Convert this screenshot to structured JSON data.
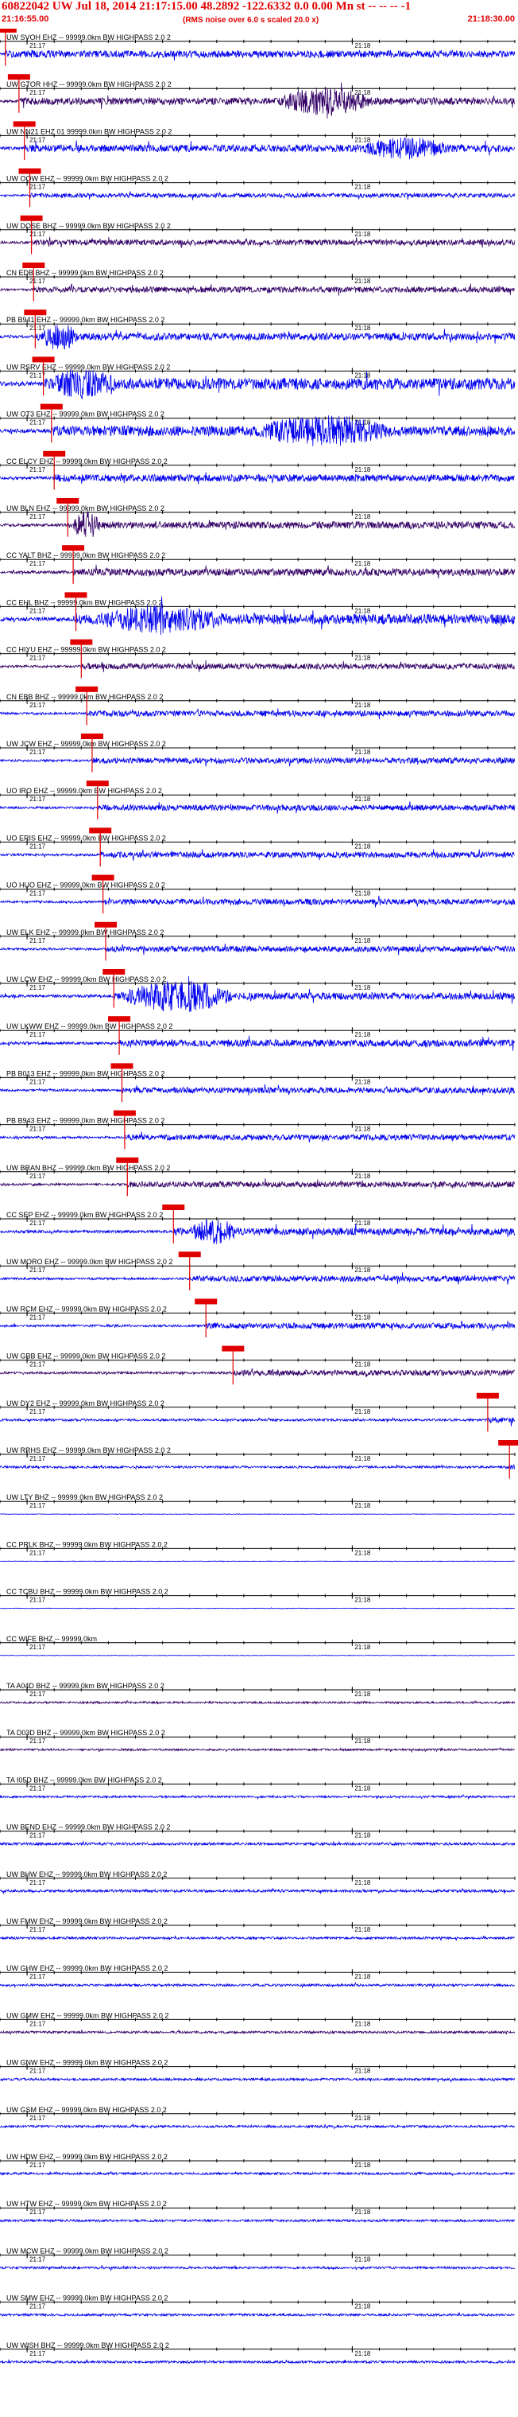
{
  "header": {
    "title": "60822042 UW Jul 18, 2014 21:17:15.00    48.2892  -122.6332   0.0 0.00 Mn st -- -- --   -1",
    "start_time": "21:16:55.00",
    "note": "(RMS noise over 6.0 s scaled 20.0 x)",
    "end_time": "21:18:30.00"
  },
  "colors": {
    "header_text": "#e00000",
    "pick_marker": "#e00000",
    "trace_blue": "#0000ee",
    "trace_purple": "#330066",
    "axis": "#000000"
  },
  "chart_data": {
    "type": "line",
    "title": "60822042 UW Jul 18, 2014 21:17:15.00    48.2892  -122.6332   0.0 0.00 Mn st -- -- --   -1",
    "x_start": "21:16:55.00",
    "x_end": "21:18:30.00",
    "minute_labels": [
      "21:17",
      "21:18"
    ],
    "series": [
      {
        "name": "UW SVOH EHZ -- 99999.0km BW  HIGHPASS  2.0  2",
        "pick": "21:16:56.0",
        "amplitude": 0.5,
        "burst": null,
        "color": "blue"
      },
      {
        "name": "UW GTOR HHZ -- 99999.0km BW  HIGHPASS  2.0  2",
        "pick": "21:16:58.5",
        "amplitude": 0.5,
        "burst": {
          "start": "21:17:45",
          "end": "21:18:05",
          "peak": 0.9
        },
        "color": "purple"
      },
      {
        "name": "UW NN21 EHZ 01 99999.0km BW  HIGHPASS  2.0  2",
        "pick": "21:16:59.5",
        "amplitude": 0.5,
        "burst": {
          "start": "21:18:00",
          "end": "21:18:20",
          "peak": 0.7
        },
        "color": "blue"
      },
      {
        "name": "UW OOW EHZ -- 99999.0km BW  HIGHPASS  2.0  2",
        "pick": "21:17:00.5",
        "amplitude": 0.3,
        "burst": null,
        "color": "blue"
      },
      {
        "name": "UW DOSE BHZ -- 99999.0km BW  HIGHPASS  2.0  2",
        "pick": "21:17:00.8",
        "amplitude": 0.4,
        "burst": null,
        "color": "purple"
      },
      {
        "name": "CN EDB BHZ -- 99999.0km BW  HIGHPASS  2.0  2",
        "pick": "21:17:01.2",
        "amplitude": 0.4,
        "burst": null,
        "color": "purple"
      },
      {
        "name": "PB B941 EHZ -- 99999.0km BW  HIGHPASS  2.0  2",
        "pick": "21:17:01.5",
        "amplitude": 0.5,
        "burst": {
          "start": "21:17:02",
          "end": "21:17:10",
          "peak": 0.9
        },
        "color": "blue"
      },
      {
        "name": "UW RSRV EHZ -- 99999.0km BW  HIGHPASS  2.0  2",
        "pick": "21:17:03.0",
        "amplitude": 0.8,
        "burst": {
          "start": "21:17:03",
          "end": "21:17:18",
          "peak": 1.0
        },
        "color": "blue"
      },
      {
        "name": "UW OT3 EHZ -- 99999.0km BW  HIGHPASS  2.0  2",
        "pick": "21:17:04.5",
        "amplitude": 0.7,
        "burst": {
          "start": "21:17:40",
          "end": "21:18:10",
          "peak": 1.0
        },
        "color": "blue"
      },
      {
        "name": "CC ELCY EHZ -- 99999.0km BW  HIGHPASS  2.0  2",
        "pick": "21:17:05.0",
        "amplitude": 0.5,
        "burst": null,
        "color": "blue"
      },
      {
        "name": "UW BLN EHZ -- 99999.0km BW  HIGHPASS  2.0  2",
        "pick": "21:17:07.5",
        "amplitude": 0.5,
        "burst": {
          "start": "21:17:08",
          "end": "21:17:14",
          "peak": 0.9
        },
        "color": "purple"
      },
      {
        "name": "CC YALT BHZ -- 99999.0km BW  HIGHPASS  2.0  2",
        "pick": "21:17:08.5",
        "amplitude": 0.5,
        "burst": null,
        "color": "purple"
      },
      {
        "name": "CC EHL BHZ -- 99999.0km BW  HIGHPASS  2.0  2",
        "pick": "21:17:09.0",
        "amplitude": 0.7,
        "burst": {
          "start": "21:17:10",
          "end": "21:17:40",
          "peak": 0.9
        },
        "color": "blue"
      },
      {
        "name": "CC HIYU EHZ -- 99999.0km BW  HIGHPASS  2.0  2",
        "pick": "21:17:10.0",
        "amplitude": 0.4,
        "burst": null,
        "color": "purple"
      },
      {
        "name": "CN EBB BHZ -- 99999.0km BW  HIGHPASS  2.0  2",
        "pick": "21:17:11.0",
        "amplitude": 0.4,
        "burst": null,
        "color": "blue"
      },
      {
        "name": "UW JCW EHZ -- 99999.0km BW  HIGHPASS  2.0  2",
        "pick": "21:17:12.0",
        "amplitude": 0.4,
        "burst": null,
        "color": "blue"
      },
      {
        "name": "UO IRO EHZ -- 99999.0km BW  HIGHPASS  2.0  2",
        "pick": "21:17:13.0",
        "amplitude": 0.4,
        "burst": null,
        "color": "blue"
      },
      {
        "name": "UO ERIS EHZ -- 99999.0km BW  HIGHPASS  2.0  2",
        "pick": "21:17:13.5",
        "amplitude": 0.4,
        "burst": null,
        "color": "blue"
      },
      {
        "name": "UO HUO EHZ -- 99999.0km BW  HIGHPASS  2.0  2",
        "pick": "21:17:14.0",
        "amplitude": 0.4,
        "burst": null,
        "color": "blue"
      },
      {
        "name": "UW ELK EHZ -- 99999.0km BW  HIGHPASS  2.0  2",
        "pick": "21:17:14.5",
        "amplitude": 0.4,
        "burst": null,
        "color": "blue"
      },
      {
        "name": "UW LCW EHZ -- 99999.0km BW  HIGHPASS  2.0  2",
        "pick": "21:17:16.0",
        "amplitude": 0.5,
        "burst": {
          "start": "21:17:16",
          "end": "21:17:40",
          "peak": 1.0
        },
        "color": "blue"
      },
      {
        "name": "UW LKWW EHZ -- 99999.0km BW  HIGHPASS  2.0  2",
        "pick": "21:17:17.0",
        "amplitude": 0.5,
        "burst": null,
        "color": "blue"
      },
      {
        "name": "PB B013 EHZ -- 99999.0km BW  HIGHPASS  2.0  2",
        "pick": "21:17:17.5",
        "amplitude": 0.4,
        "burst": null,
        "color": "blue"
      },
      {
        "name": "PB B943 EHZ -- 99999.0km BW  HIGHPASS  2.0  2",
        "pick": "21:17:18.0",
        "amplitude": 0.4,
        "burst": null,
        "color": "blue"
      },
      {
        "name": "UW BRAN BHZ -- 99999.0km BW  HIGHPASS  2.0  2",
        "pick": "21:17:18.5",
        "amplitude": 0.4,
        "burst": null,
        "color": "purple"
      },
      {
        "name": "CC SEP EHZ -- 99999.0km BW  HIGHPASS  2.0  2",
        "pick": "21:17:27.0",
        "amplitude": 0.5,
        "burst": {
          "start": "21:17:29",
          "end": "21:17:40",
          "peak": 0.8
        },
        "color": "blue"
      },
      {
        "name": "UW MORO EHZ -- 99999.0km BW  HIGHPASS  2.0  2",
        "pick": "21:17:30.0",
        "amplitude": 0.4,
        "burst": null,
        "color": "blue"
      },
      {
        "name": "UW RCM EHZ -- 99999.0km BW  HIGHPASS  2.0  2",
        "pick": "21:17:33.0",
        "amplitude": 0.4,
        "burst": null,
        "color": "blue"
      },
      {
        "name": "UW GBB EHZ -- 99999.0km BW  HIGHPASS  2.0  2",
        "pick": "21:17:38.0",
        "amplitude": 0.4,
        "burst": null,
        "color": "purple"
      },
      {
        "name": "UW DY2 EHZ -- 99999.0km BW  HIGHPASS  2.0  2",
        "pick": "21:18:25.0",
        "amplitude": 0.4,
        "burst": null,
        "color": "blue"
      },
      {
        "name": "UW RRHS EHZ -- 99999.0km BW  HIGHPASS  2.0  2",
        "pick": "21:18:29.0",
        "amplitude": 0.4,
        "burst": null,
        "color": "blue"
      },
      {
        "name": "UW LTY BHZ -- 99999.0km BW  HIGHPASS  2.0  2",
        "pick": null,
        "amplitude": 0.1,
        "burst": null,
        "color": "blue"
      },
      {
        "name": "CC PRLK BHZ -- 99999.0km BW  HIGHPASS  2.0  2",
        "pick": null,
        "amplitude": 0.1,
        "burst": null,
        "color": "blue"
      },
      {
        "name": "CC TCBU BHZ -- 99999.0km BW  HIGHPASS  2.0  2",
        "pick": null,
        "amplitude": 0.1,
        "burst": null,
        "color": "blue"
      },
      {
        "name": "CC WIFE BHZ -- 99999.0km",
        "pick": null,
        "amplitude": 0.1,
        "burst": null,
        "color": "blue"
      },
      {
        "name": "TA A04D BHZ -- 99999.0km BW  HIGHPASS  2.0  2",
        "pick": null,
        "amplitude": 0.35,
        "burst": null,
        "color": "purple"
      },
      {
        "name": "TA D03D BHZ -- 99999.0km BW  HIGHPASS  2.0  2",
        "pick": null,
        "amplitude": 0.35,
        "burst": null,
        "color": "purple"
      },
      {
        "name": "TA I05D BHZ -- 99999.0km BW  HIGHPASS  2.0  2",
        "pick": null,
        "amplitude": 0.35,
        "burst": null,
        "color": "blue"
      },
      {
        "name": "UW BEND EHZ -- 99999.0km BW  HIGHPASS  2.0  2",
        "pick": null,
        "amplitude": 0.45,
        "burst": null,
        "color": "blue"
      },
      {
        "name": "UW BHW EHZ -- 99999.0km BW  HIGHPASS  2.0  2",
        "pick": null,
        "amplitude": 0.45,
        "burst": null,
        "color": "blue"
      },
      {
        "name": "UW FMW EHZ -- 99999.0km BW  HIGHPASS  2.0  2",
        "pick": null,
        "amplitude": 0.4,
        "burst": null,
        "color": "blue"
      },
      {
        "name": "UW GHW EHZ -- 99999.0km BW  HIGHPASS  2.0  2",
        "pick": null,
        "amplitude": 0.4,
        "burst": null,
        "color": "blue"
      },
      {
        "name": "UW GMW EHZ -- 99999.0km BW  HIGHPASS  2.0  2",
        "pick": null,
        "amplitude": 0.4,
        "burst": null,
        "color": "purple"
      },
      {
        "name": "UW GNW EHZ -- 99999.0km BW  HIGHPASS  2.0  2",
        "pick": null,
        "amplitude": 0.4,
        "burst": null,
        "color": "blue"
      },
      {
        "name": "UW GSM EHZ -- 99999.0km BW  HIGHPASS  2.0  2",
        "pick": null,
        "amplitude": 0.4,
        "burst": null,
        "color": "blue"
      },
      {
        "name": "UW HDW EHZ -- 99999.0km BW  HIGHPASS  2.0  2",
        "pick": null,
        "amplitude": 0.4,
        "burst": null,
        "color": "blue"
      },
      {
        "name": "UW HTW EHZ -- 99999.0km BW  HIGHPASS  2.0  2",
        "pick": null,
        "amplitude": 0.4,
        "burst": null,
        "color": "blue"
      },
      {
        "name": "UW MCW EHZ -- 99999.0km BW  HIGHPASS  2.0  2",
        "pick": null,
        "amplitude": 0.4,
        "burst": null,
        "color": "blue"
      },
      {
        "name": "UW SMW EHZ -- 99999.0km BW  HIGHPASS  2.0  2",
        "pick": null,
        "amplitude": 0.4,
        "burst": null,
        "color": "blue"
      },
      {
        "name": "UW WISH BHZ -- 99999.0km BW  HIGHPASS  2.0  2",
        "pick": null,
        "amplitude": 0.4,
        "burst": null,
        "color": "blue"
      }
    ]
  }
}
